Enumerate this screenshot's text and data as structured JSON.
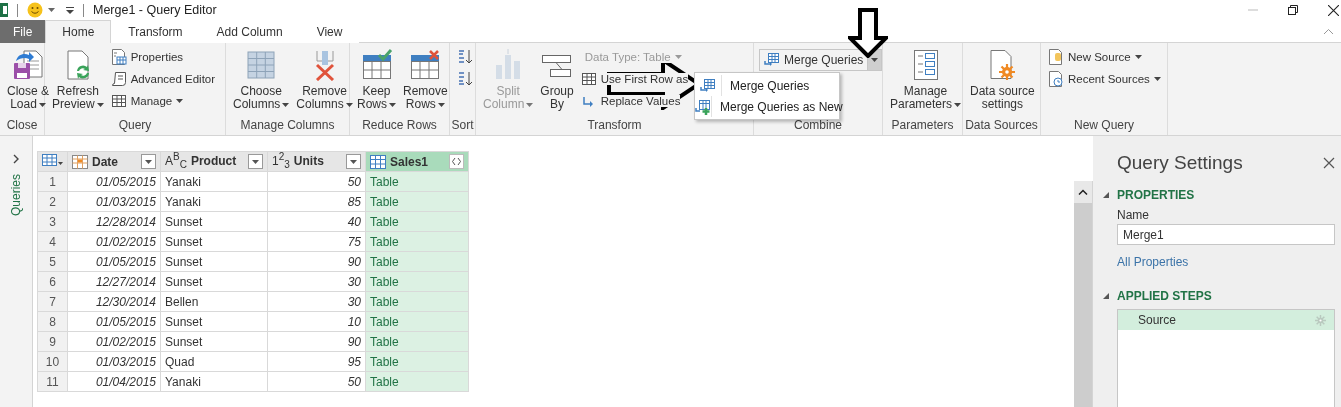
{
  "title_bar": {
    "title": "Merge1 - Query Editor"
  },
  "tabs": [
    {
      "label": "File",
      "kind": "file",
      "selected": false
    },
    {
      "label": "Home",
      "kind": "tab",
      "selected": true
    },
    {
      "label": "Transform",
      "kind": "tab",
      "selected": false
    },
    {
      "label": "Add Column",
      "kind": "tab",
      "selected": false
    },
    {
      "label": "View",
      "kind": "tab",
      "selected": false
    }
  ],
  "ribbon_groups": [
    {
      "label": "Close",
      "items": [
        {
          "kind": "large",
          "lines": [
            "Close &",
            "Load"
          ],
          "dropdown": true,
          "disabled": false
        }
      ]
    },
    {
      "label": "Query",
      "items": [
        {
          "kind": "large",
          "lines": [
            "Refresh",
            "Preview"
          ],
          "dropdown": true,
          "disabled": false
        },
        {
          "kind": "stack",
          "buttons": [
            {
              "label": "Properties",
              "dropdown": false,
              "disabled": false
            },
            {
              "label": "Advanced Editor",
              "dropdown": false,
              "disabled": false
            },
            {
              "label": "Manage",
              "dropdown": true,
              "disabled": false
            }
          ]
        }
      ]
    },
    {
      "label": "Manage Columns",
      "items": [
        {
          "kind": "large",
          "lines": [
            "Choose",
            "Columns"
          ],
          "dropdown": true,
          "disabled": false
        },
        {
          "kind": "large",
          "lines": [
            "Remove",
            "Columns"
          ],
          "dropdown": true,
          "disabled": false
        }
      ]
    },
    {
      "label": "Reduce Rows",
      "items": [
        {
          "kind": "large",
          "lines": [
            "Keep",
            "Rows"
          ],
          "dropdown": true,
          "disabled": false
        },
        {
          "kind": "large",
          "lines": [
            "Remove",
            "Rows"
          ],
          "dropdown": true,
          "disabled": false
        }
      ]
    },
    {
      "label": "Sort",
      "items": [
        {
          "kind": "stack",
          "buttons": [
            {
              "dropdown": false,
              "disabled": false
            },
            {
              "dropdown": false,
              "disabled": false
            }
          ]
        }
      ]
    },
    {
      "label": "Transform",
      "items": [
        {
          "kind": "large",
          "lines": [
            "Split",
            "Column"
          ],
          "dropdown": true,
          "disabled": true
        },
        {
          "kind": "large",
          "lines": [
            "Group",
            "By"
          ],
          "dropdown": false,
          "disabled": false
        },
        {
          "kind": "stack",
          "buttons": [
            {
              "label": "Data Type: Table",
              "dropdown": true,
              "disabled": true
            },
            {
              "label": "Use First Row as",
              "dropdown": false,
              "disabled": false
            },
            {
              "label": "Replace Values",
              "dropdown": false,
              "disabled": false
            }
          ]
        }
      ]
    },
    {
      "label": "Combine",
      "items": [
        {
          "kind": "split",
          "label": "Merge Queries",
          "open": true
        }
      ]
    },
    {
      "label": "Parameters",
      "items": [
        {
          "kind": "large",
          "lines": [
            "Manage",
            "Parameters"
          ],
          "dropdown": true,
          "disabled": false
        }
      ]
    },
    {
      "label": "Data Sources",
      "items": [
        {
          "kind": "large",
          "lines": [
            "Data source",
            "settings"
          ],
          "dropdown": false,
          "disabled": false
        }
      ]
    },
    {
      "label": "New Query",
      "items": [
        {
          "kind": "stack",
          "buttons": [
            {
              "label": "New Source",
              "dropdown": true,
              "disabled": false
            },
            {
              "label": "Recent Sources",
              "dropdown": true,
              "disabled": false
            }
          ]
        }
      ]
    }
  ],
  "merge_menu": {
    "items": [
      {
        "label": "Merge Queries"
      },
      {
        "label": "Merge Queries as New"
      }
    ]
  },
  "queries_pane": {
    "label": "Queries"
  },
  "table": {
    "columns": [
      {
        "name": "Date",
        "kind": "date",
        "selected": false
      },
      {
        "name": "Product",
        "kind": "text",
        "type_mark": "A$^{B}$$_{C}$",
        "selected": false
      },
      {
        "name": "Units",
        "kind": "number",
        "type_mark": "1$^{2}$$_{3}$",
        "selected": false
      },
      {
        "name": "Sales1",
        "kind": "table",
        "selected": true
      }
    ],
    "rows": [
      {
        "row_number": "1",
        "cells": [
          "01/05/2015",
          "Yanaki",
          "50",
          "Table"
        ]
      },
      {
        "row_number": "2",
        "cells": [
          "01/03/2015",
          "Yanaki",
          "85",
          "Table"
        ]
      },
      {
        "row_number": "3",
        "cells": [
          "12/28/2014",
          "Sunset",
          "40",
          "Table"
        ]
      },
      {
        "row_number": "4",
        "cells": [
          "01/02/2015",
          "Sunset",
          "75",
          "Table"
        ]
      },
      {
        "row_number": "5",
        "cells": [
          "01/05/2015",
          "Sunset",
          "90",
          "Table"
        ]
      },
      {
        "row_number": "6",
        "cells": [
          "12/27/2014",
          "Sunset",
          "30",
          "Table"
        ]
      },
      {
        "row_number": "7",
        "cells": [
          "12/30/2014",
          "Bellen",
          "30",
          "Table"
        ]
      },
      {
        "row_number": "8",
        "cells": [
          "01/05/2015",
          "Sunset",
          "10",
          "Table"
        ]
      },
      {
        "row_number": "9",
        "cells": [
          "01/02/2015",
          "Sunset",
          "90",
          "Table"
        ]
      },
      {
        "row_number": "10",
        "cells": [
          "01/03/2015",
          "Quad",
          "95",
          "Table"
        ]
      },
      {
        "row_number": "11",
        "cells": [
          "01/04/2015",
          "Yanaki",
          "50",
          "Table"
        ]
      }
    ]
  },
  "query_settings": {
    "title": "Query Settings",
    "properties": {
      "heading": "PROPERTIES",
      "name_label": "Name",
      "name_value": "Merge1",
      "link": "All Properties"
    },
    "applied_steps": {
      "heading": "APPLIED STEPS",
      "steps": [
        {
          "label": "Source",
          "selected": true
        }
      ]
    }
  }
}
